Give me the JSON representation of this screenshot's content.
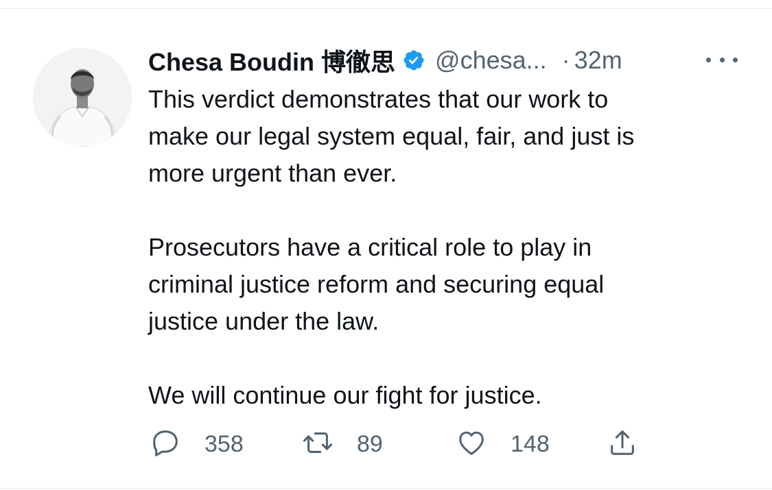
{
  "tweet": {
    "display_name": "Chesa Boudin 博徹思",
    "handle": "@chesa...",
    "separator": "·",
    "time": "32m",
    "verified": true,
    "paragraphs": [
      "This verdict demonstrates that our work to\nmake our legal system equal, fair, and just is\nmore urgent than ever.",
      "Prosecutors have a critical role to play in\ncriminal justice reform and securing equal\njustice under the law.",
      "We will continue our fight for justice."
    ],
    "actions": {
      "reply_count": "358",
      "retweet_count": "89",
      "like_count": "148"
    }
  },
  "icons": {
    "verified": "verified-badge-icon",
    "more": "more-options-icon",
    "reply": "reply-icon",
    "retweet": "retweet-icon",
    "like": "heart-icon",
    "share": "share-icon"
  },
  "colors": {
    "text": "#0f1419",
    "secondary": "#536471",
    "verified": "#1d9bf0",
    "divider": "#e6ecf0"
  }
}
